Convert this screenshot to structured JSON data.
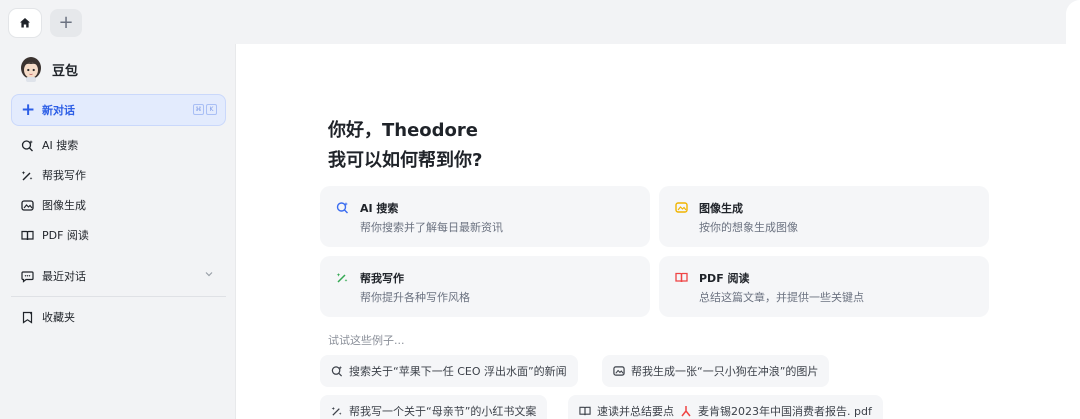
{
  "tabbar": {
    "home_icon": "home-icon",
    "add_tab_glyph": "+"
  },
  "sidebar": {
    "brand_name": "豆包",
    "new_chat": {
      "label": "新对话",
      "shortcut": [
        "⌘",
        "K"
      ]
    },
    "items": [
      {
        "label": "AI 搜索",
        "icon": "ai-search-icon"
      },
      {
        "label": "帮我写作",
        "icon": "pen-sparkle-icon"
      },
      {
        "label": "图像生成",
        "icon": "image-icon"
      },
      {
        "label": "PDF 阅读",
        "icon": "book-icon"
      }
    ],
    "recent": {
      "label": "最近对话",
      "icon": "chat-bubble-icon"
    },
    "favorites": {
      "label": "收藏夹",
      "icon": "bookmark-icon"
    }
  },
  "main": {
    "greeting_line1": "你好，Theodore",
    "greeting_line2": "我可以如何帮到你?",
    "cards": [
      {
        "title": "AI 搜索",
        "desc": "帮你搜索并了解每日最新资讯",
        "icon": "ai-search-icon"
      },
      {
        "title": "图像生成",
        "desc": "按你的想象生成图像",
        "icon": "image-icon"
      },
      {
        "title": "帮我写作",
        "desc": "帮你提升各种写作风格",
        "icon": "pen-sparkle-icon"
      },
      {
        "title": "PDF 阅读",
        "desc": "总结这篇文章，并提供一些关键点",
        "icon": "book-icon"
      }
    ],
    "try_label": "试试这些例子...",
    "examples": [
      {
        "label": "搜索关于“苹果下一任 CEO 浮出水面”的新闻",
        "icon": "ai-search-icon"
      },
      {
        "label": "帮我生成一张“一只小狗在冲浪”的图片",
        "icon": "image-icon"
      },
      {
        "label": "帮我写一个关于“母亲节”的小红书文案",
        "icon": "pen-sparkle-icon"
      },
      {
        "label": "速读并总结要点",
        "file": "麦肯锡2023年中国消费者报告. pdf",
        "icon": "book-icon",
        "file_icon": "pdf-icon"
      }
    ]
  },
  "colors": {
    "accent": "#2c5ee6",
    "search_blue": "#3a6cf0",
    "image_yellow": "#f0b400",
    "write_green": "#34a853",
    "pdf_red": "#ef4444"
  }
}
